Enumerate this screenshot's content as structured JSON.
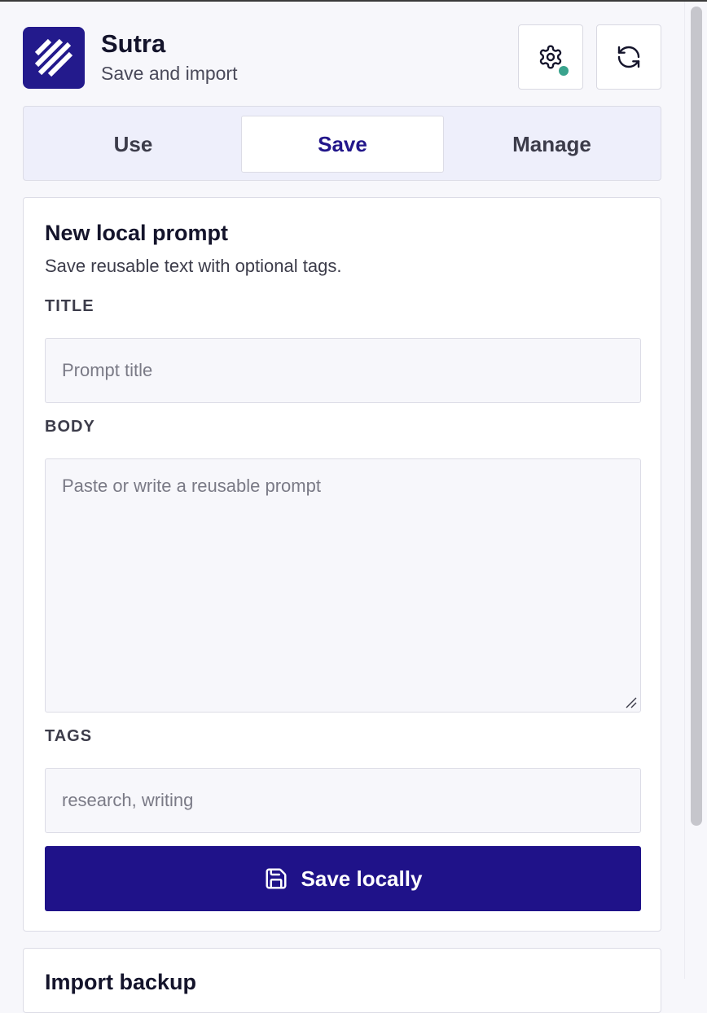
{
  "header": {
    "app_name": "Sutra",
    "subtitle": "Save and import",
    "logo_icon": "sutra-logo-icon",
    "settings_icon": "gear-icon",
    "refresh_icon": "refresh-icon",
    "status_color": "#3aa38d"
  },
  "tabs": [
    {
      "label": "Use",
      "active": false
    },
    {
      "label": "Save",
      "active": true
    },
    {
      "label": "Manage",
      "active": false
    }
  ],
  "form": {
    "title": "New local prompt",
    "subtitle": "Save reusable text with optional tags.",
    "title_label": "TITLE",
    "title_placeholder": "Prompt title",
    "body_label": "BODY",
    "body_placeholder": "Paste or write a reusable prompt",
    "tags_label": "TAGS",
    "tags_placeholder": "research, writing",
    "save_label": "Save locally",
    "save_icon": "floppy-disk-icon"
  },
  "import_card": {
    "title": "Import backup"
  },
  "colors": {
    "accent": "#1f1289",
    "background": "#f7f7fb"
  }
}
